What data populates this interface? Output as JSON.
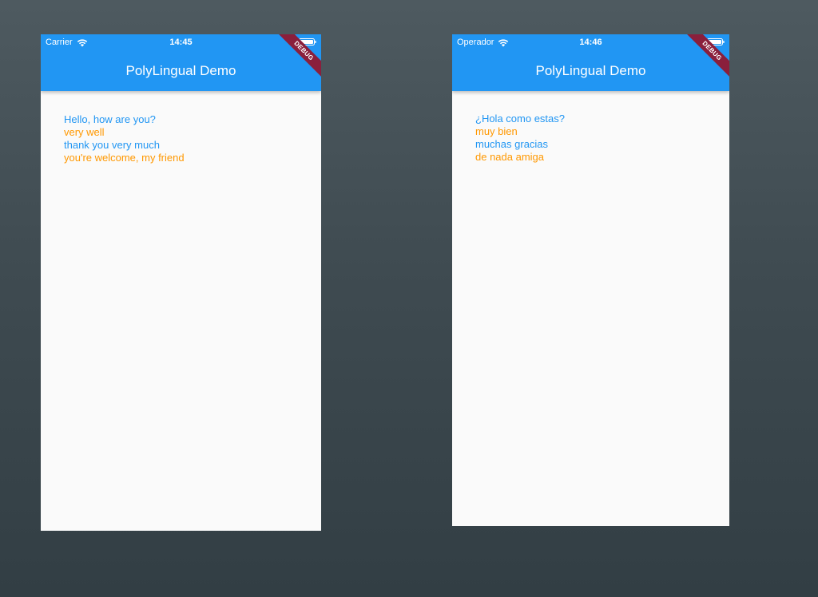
{
  "colors": {
    "app_bar": "#2196f3",
    "phrase_blue": "#2196f3",
    "phrase_orange": "#ff9800",
    "debug_ribbon": "#8a1f3c",
    "screen_background": "#fafafa"
  },
  "screens": [
    {
      "status": {
        "carrier": "Carrier",
        "time": "14:45"
      },
      "title": "PolyLingual Demo",
      "debug_label": "DEBUG",
      "lines": [
        {
          "text": "Hello, how are you?",
          "color": "blue"
        },
        {
          "text": "very well",
          "color": "orange"
        },
        {
          "text": "thank you very much",
          "color": "blue"
        },
        {
          "text": "you're welcome, my friend",
          "color": "orange"
        }
      ]
    },
    {
      "status": {
        "carrier": "Operador",
        "time": "14:46"
      },
      "title": "PolyLingual Demo",
      "debug_label": "DEBUG",
      "lines": [
        {
          "text": "¿Hola como estas?",
          "color": "blue"
        },
        {
          "text": "muy bien",
          "color": "orange"
        },
        {
          "text": "muchas gracias",
          "color": "blue"
        },
        {
          "text": "de nada amiga",
          "color": "orange"
        }
      ]
    }
  ],
  "icons": {
    "wifi": "wifi-icon",
    "battery": "battery-icon"
  }
}
